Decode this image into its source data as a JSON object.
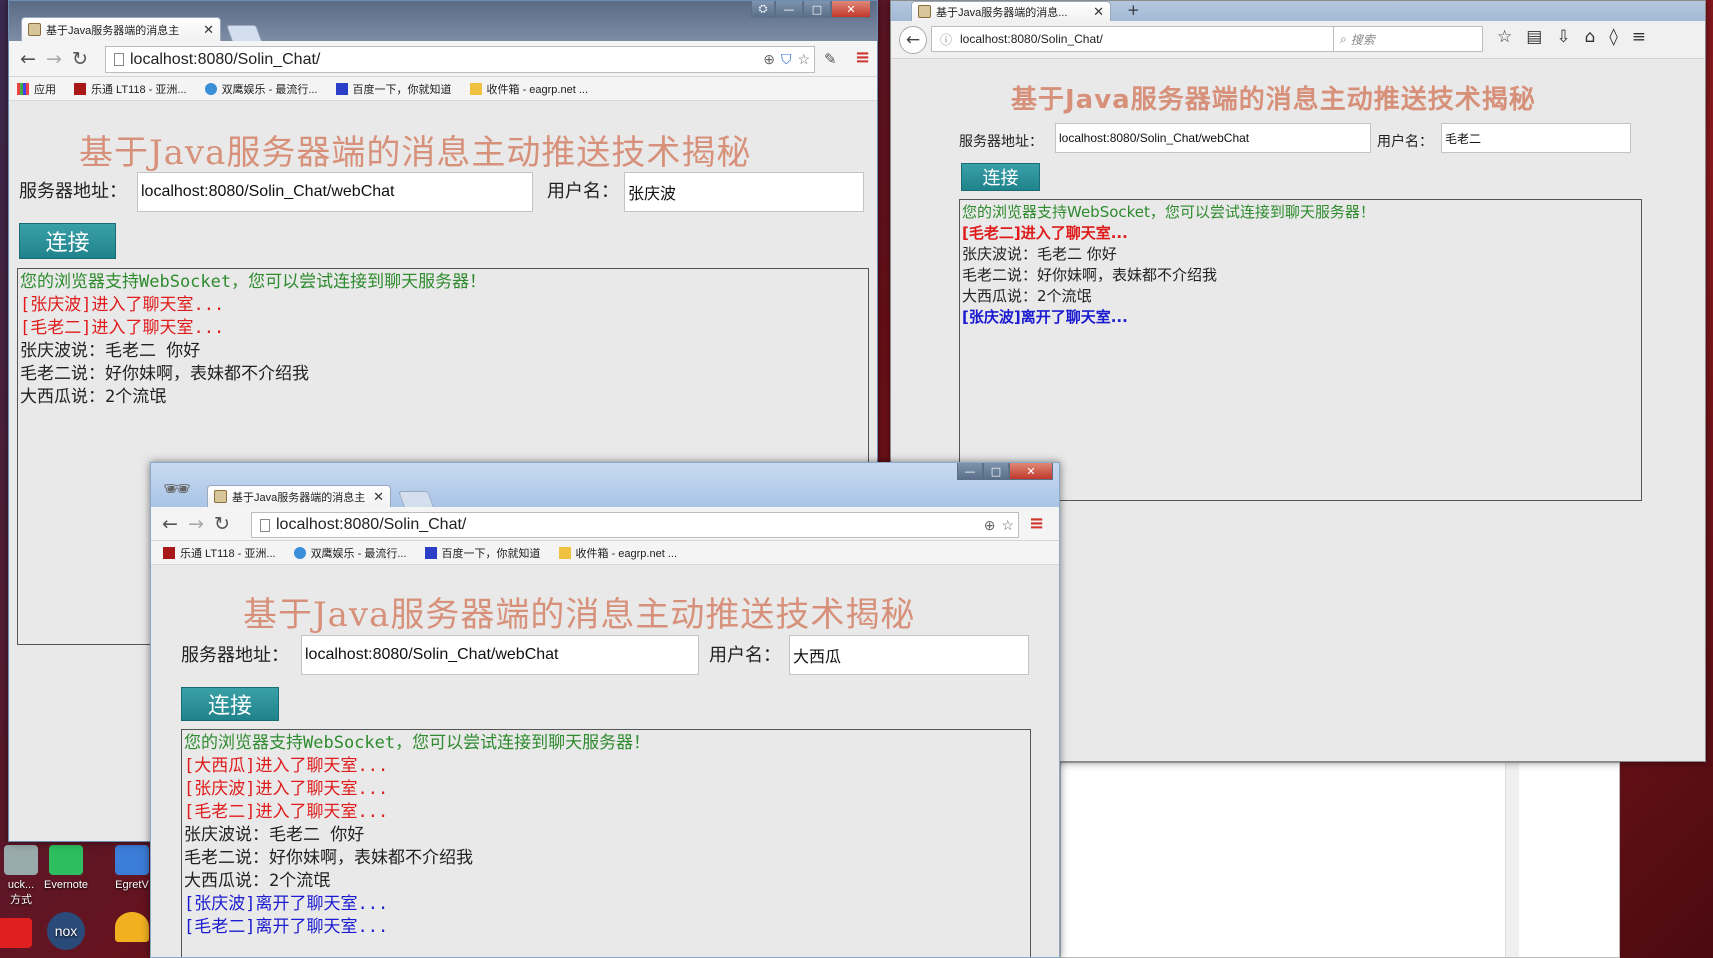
{
  "desktop": {
    "icons": [
      {
        "label": "Evernote",
        "color": "#2dbe60"
      },
      {
        "label": "EgretV",
        "color": "#3b7dd8"
      },
      {
        "label": "uck...\n方式",
        "color": "#ffffff"
      },
      {
        "label": "",
        "color": "#e02020"
      },
      {
        "label": "",
        "color": "#2a4a7a"
      },
      {
        "label": "",
        "color": "#f0b020"
      }
    ]
  },
  "shared": {
    "tab_title": "基于Java服务器端的消息主",
    "tab_title_ff": "基于Java服务器端的消息...",
    "url": "localhost:8080/Solin_Chat/",
    "heading": "基于Java服务器端的消息主动推送技术揭秘",
    "server_label": "服务器地址：",
    "server_value": "localhost:8080/Solin_Chat/webChat",
    "user_label": "用户名：",
    "connect_label": "连接",
    "support_msg": "您的浏览器支持WebSocket，您可以尝试连接到聊天服务器！",
    "search_placeholder": "搜索",
    "bookmarks": [
      "应用",
      "乐通 LT118 - 亚洲...",
      "双鹰娱乐 - 最流行...",
      "百度一下，你就知道",
      "收件箱 - eagrp.net ..."
    ],
    "bookmarks_short": [
      "乐通 LT118 - 亚洲...",
      "双鹰娱乐 - 最流行...",
      "百度一下，你就知道",
      "收件箱 - eagrp.net ..."
    ]
  },
  "win1": {
    "username": "张庆波",
    "messages": [
      {
        "type": "sys",
        "text": "您的浏览器支持WebSocket，您可以尝试连接到聊天服务器！"
      },
      {
        "type": "join",
        "text": "[张庆波]进入了聊天室..."
      },
      {
        "type": "join",
        "text": "[毛老二]进入了聊天室..."
      },
      {
        "type": "chat",
        "text": "张庆波说：毛老二 你好"
      },
      {
        "type": "chat",
        "text": "毛老二说：好你妹啊，表妹都不介绍我"
      },
      {
        "type": "chat",
        "text": "大西瓜说：2个流氓"
      }
    ]
  },
  "win2": {
    "username": "毛老二",
    "messages": [
      {
        "type": "sys",
        "text": "您的浏览器支持WebSocket，您可以尝试连接到聊天服务器！"
      },
      {
        "type": "join",
        "text": "[毛老二]进入了聊天室..."
      },
      {
        "type": "chat",
        "text": "张庆波说：毛老二 你好"
      },
      {
        "type": "chat",
        "text": "毛老二说：好你妹啊，表妹都不介绍我"
      },
      {
        "type": "chat",
        "text": "大西瓜说：2个流氓"
      },
      {
        "type": "leave",
        "text": "[张庆波]离开了聊天室..."
      }
    ]
  },
  "win3": {
    "username": "大西瓜",
    "messages": [
      {
        "type": "sys",
        "text": "您的浏览器支持WebSocket，您可以尝试连接到聊天服务器！"
      },
      {
        "type": "join",
        "text": "[大西瓜]进入了聊天室..."
      },
      {
        "type": "join",
        "text": "[张庆波]进入了聊天室..."
      },
      {
        "type": "join",
        "text": "[毛老二]进入了聊天室..."
      },
      {
        "type": "chat",
        "text": "张庆波说：毛老二 你好"
      },
      {
        "type": "chat",
        "text": "毛老二说：好你妹啊，表妹都不介绍我"
      },
      {
        "type": "chat",
        "text": "大西瓜说：2个流氓"
      },
      {
        "type": "leave",
        "text": "[张庆波]离开了聊天室..."
      },
      {
        "type": "leave",
        "text": "[毛老二]离开了聊天室..."
      }
    ]
  },
  "colors": {
    "heading": "#d7917a",
    "sys": "#2e8b2e",
    "join": "#e01b1b",
    "leave": "#1a1ad0",
    "connect_button": "#2a939b"
  }
}
